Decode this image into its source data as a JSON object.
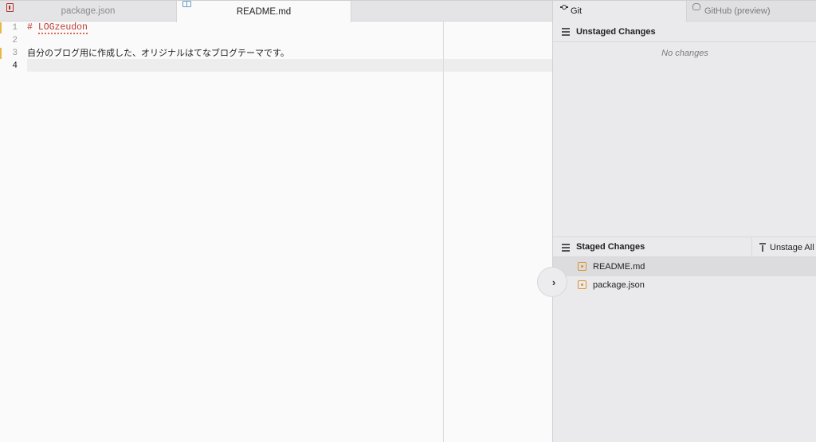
{
  "editor": {
    "tabs": [
      {
        "label": "package.json",
        "active": false
      },
      {
        "label": "README.md",
        "active": true
      }
    ],
    "line_numbers": [
      "1",
      "2",
      "3",
      "4"
    ],
    "lines": {
      "heading_hash": "# ",
      "heading_word": "LOGzeudon",
      "line3": "自分のブログ用に作成した、オリジナルはてなブログテーマです。"
    },
    "toggle_icon": "chevron-right"
  },
  "git_panel": {
    "tabs": [
      {
        "label": "Git",
        "icon": "git-commit-icon"
      },
      {
        "label": "GitHub (preview)",
        "icon": "github-octocat-icon"
      }
    ],
    "unstaged": {
      "title": "Unstaged Changes",
      "empty_text": "No changes"
    },
    "staged": {
      "title": "Staged Changes",
      "unstage_all_label": "Unstage All",
      "files": [
        {
          "name": "README.md",
          "status": "modified",
          "selected": true
        },
        {
          "name": "package.json",
          "status": "modified",
          "selected": false
        }
      ]
    }
  },
  "colors": {
    "modified": "#d9962a",
    "heading": "#c0392b",
    "gutter_mark": "#e6b84a"
  }
}
